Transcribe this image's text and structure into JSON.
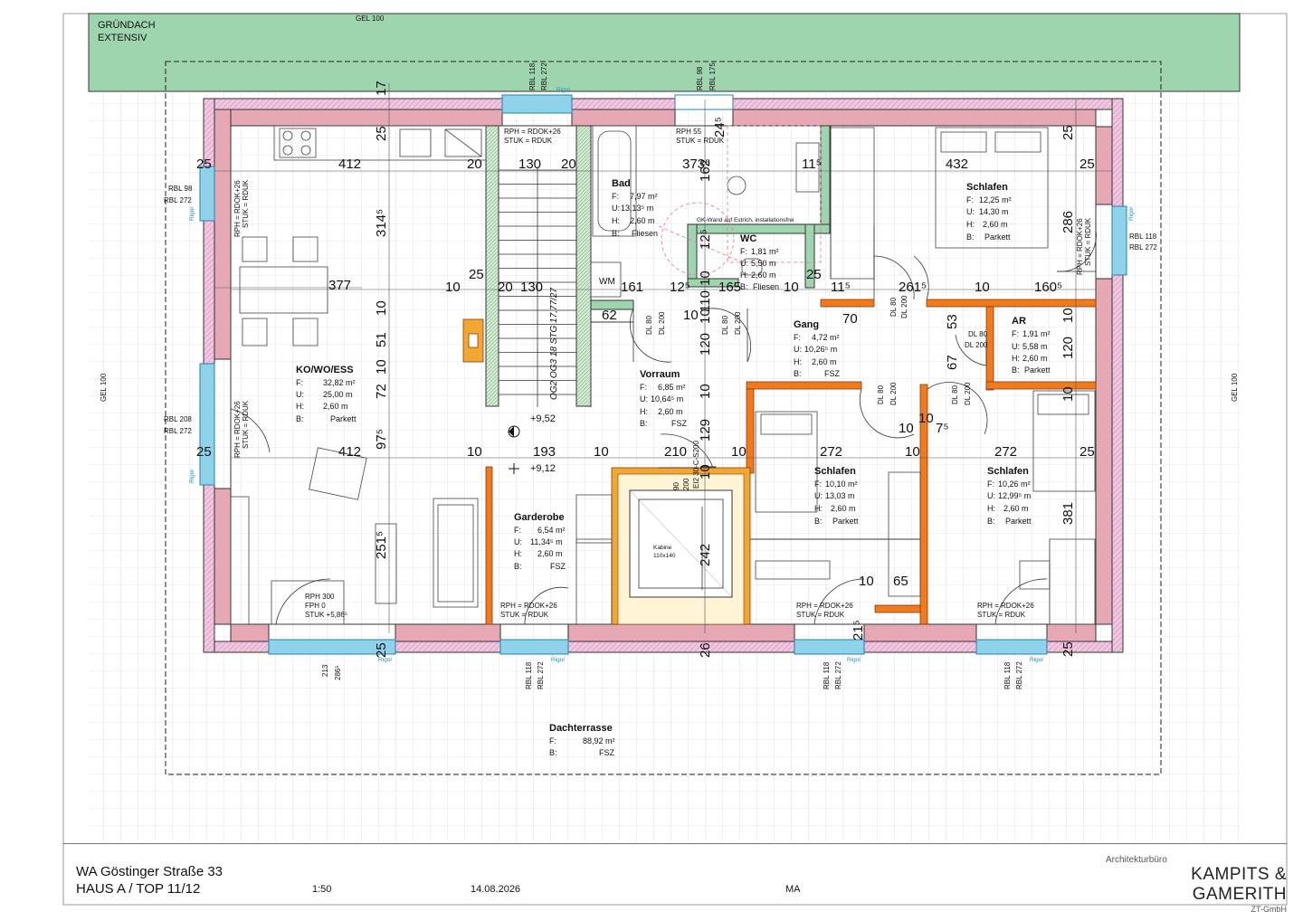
{
  "roof": {
    "label_1": "GRÜNDACH",
    "label_2": "EXTENSIV",
    "gel_top": "GEL 100",
    "gel_left": "GEL 100",
    "gel_right": "GEL 100"
  },
  "rooms": {
    "kowoess": {
      "name": "KO/WO/ESS",
      "f_label": "F:",
      "f": "32,82 m²",
      "u_label": "U:",
      "u": "25,00 m",
      "h_label": "H:",
      "h": "2,60 m",
      "b_label": "B:",
      "b": "Parkett"
    },
    "bad": {
      "name": "Bad",
      "f_label": "F:",
      "f": "7,97 m²",
      "u_label": "U:",
      "u": "13,13⁵ m",
      "h_label": "H:",
      "h": "2,60 m",
      "b_label": "B:",
      "b": "Fliesen"
    },
    "wc": {
      "name": "WC",
      "f_label": "F:",
      "f": "1,81 m²",
      "u_label": "U:",
      "u": "5,50 m",
      "h_label": "H:",
      "h": "2,60 m",
      "b_label": "B:",
      "b": "Fliesen"
    },
    "schlafen1": {
      "name": "Schlafen",
      "f_label": "F:",
      "f": "12,25 m²",
      "u_label": "U:",
      "u": "14,30 m",
      "h_label": "H:",
      "h": "2,60 m",
      "b_label": "B:",
      "b": "Parkett"
    },
    "gang": {
      "name": "Gang",
      "f_label": "F:",
      "f": "4,72 m²",
      "u_label": "U:",
      "u": "10,26⁵ m",
      "h_label": "H:",
      "h": "2,60 m",
      "b_label": "B:",
      "b": "FSZ"
    },
    "ar": {
      "name": "AR",
      "f_label": "F:",
      "f": "1,91 m²",
      "u_label": "U:",
      "u": "5,58 m",
      "h_label": "H:",
      "h": "2,60 m",
      "b_label": "B:",
      "b": "Parkett"
    },
    "vorraum": {
      "name": "Vorraum",
      "f_label": "F:",
      "f": "6,85 m²",
      "u_label": "U:",
      "u": "10,64⁵ m",
      "h_label": "H:",
      "h": "2,60 m",
      "b_label": "B:",
      "b": "FSZ"
    },
    "garderobe": {
      "name": "Garderobe",
      "f_label": "F:",
      "f": "6,54 m²",
      "u_label": "U:",
      "u": "11,34⁵ m",
      "h_label": "H:",
      "h": "2,60 m",
      "b_label": "B:",
      "b": "FSZ"
    },
    "schlafen2": {
      "name": "Schlafen",
      "f_label": "F:",
      "f": "10,10 m²",
      "u_label": "U:",
      "u": "13,03 m",
      "h_label": "H:",
      "h": "2,60 m",
      "b_label": "B:",
      "b": "Parkett"
    },
    "schlafen3": {
      "name": "Schlafen",
      "f_label": "F:",
      "f": "10,26 m²",
      "u_label": "U:",
      "u": "12,99⁵ m",
      "h_label": "H:",
      "h": "2,60 m",
      "b_label": "B:",
      "b": "Parkett"
    },
    "terrasse": {
      "name": "Dachterrasse",
      "f_label": "F:",
      "f": "88,92 m²",
      "b_label": "B:",
      "b": "FSZ"
    }
  },
  "annotations": {
    "rph_rdok_26": "RPH = RDOK+26",
    "stuk_rduk": "STUK = RDUK",
    "rph_55": "RPH 55",
    "rph_300": "RPH 300",
    "fph_0": "FPH 0",
    "stuk_586": "STUK +5,86⁵",
    "gk_wand": "GK-Wand auf Estrich, installationsfrei",
    "wm": "WM",
    "kabine": "Kabine",
    "kabine_size": "110x140",
    "level_952": "+9,52",
    "level_912": "+9,12",
    "stair": "OG2 OG3 18 STG 17,77/27",
    "ei_door": "EI2 30-C-S200",
    "rigol": "Rigol",
    "dl_80": "DL 80",
    "dl_200": "DL 200"
  },
  "windows": {
    "rbl_118": "RBL 118",
    "rbl_272": "RBL 272",
    "rbl_98": "RBL 98",
    "rbl_175": "RBL 175",
    "rbl_208": "RBL 208",
    "dim_213": "213",
    "dim_286": "286⁵"
  },
  "dims": {
    "d412": "412",
    "d3145": "314⁵",
    "d377": "377",
    "d10": "10",
    "d51": "51",
    "d72": "72",
    "d975": "97⁵",
    "d2515": "251⁵",
    "d25": "25",
    "d20": "20",
    "d130": "130",
    "d3735": "373⁵",
    "d162": "162",
    "d245": "24⁵",
    "d115": "11⁵",
    "d125": "12⁵",
    "d110": "110",
    "d165": "165",
    "d161": "161",
    "d62": "62",
    "d120": "120",
    "d129": "129",
    "d193": "193",
    "d210": "210",
    "d242": "242",
    "d90": "90",
    "d200": "200",
    "d17": "17",
    "d432": "432",
    "d286": "286",
    "d2615": "261⁵",
    "d1605": "160⁵",
    "d70": "70",
    "d53": "53",
    "d67": "67",
    "d272": "272",
    "d75": "7⁵",
    "d381": "381",
    "d65": "65",
    "d215": "21⁵",
    "d26": "26"
  },
  "title_block": {
    "project": "WA Göstinger Straße 33",
    "unit": "HAUS A / TOP 11/12",
    "scale": "1:50",
    "date": "14.08.2026",
    "drawer": "MA",
    "firm_1": "Architekturbüro",
    "firm_2": "KAMPITS & GAMERITH",
    "firm_3": "ZT-GmbH"
  }
}
